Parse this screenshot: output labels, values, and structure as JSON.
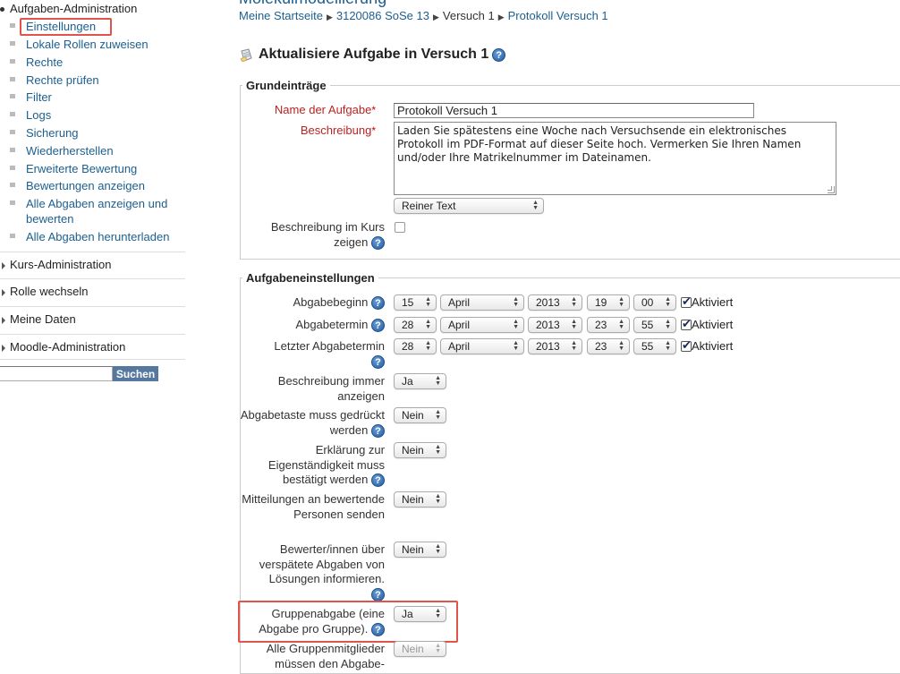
{
  "sidebar": {
    "section_title": "Aufgaben-Administration",
    "items": [
      {
        "label": "Einstellungen"
      },
      {
        "label": "Lokale Rollen zuweisen"
      },
      {
        "label": "Rechte"
      },
      {
        "label": "Rechte prüfen"
      },
      {
        "label": "Filter"
      },
      {
        "label": "Logs"
      },
      {
        "label": "Sicherung"
      },
      {
        "label": "Wiederherstellen"
      },
      {
        "label": "Erweiterte Bewertung"
      },
      {
        "label": "Bewertungen anzeigen"
      },
      {
        "label": "Alle Abgaben anzeigen und bewerten"
      },
      {
        "label": "Alle Abgaben herunterladen"
      }
    ],
    "blocks": [
      {
        "label": "Kurs-Administration"
      },
      {
        "label": "Rolle wechseln"
      },
      {
        "label": "Meine Daten"
      },
      {
        "label": "Moodle-Administration"
      }
    ],
    "search": {
      "value": "",
      "button_label": "Suchen"
    }
  },
  "header": {
    "course_title": "Molekülmodellierung",
    "breadcrumb": [
      "Meine Startseite",
      "3120086 SoSe 13",
      "Versuch 1",
      "Protokoll Versuch 1"
    ]
  },
  "page": {
    "heading": "Aktualisiere Aufgabe in Versuch 1",
    "help_symbol": "?"
  },
  "grundeintraege": {
    "legend": "Grundeinträge",
    "name_label": "Name der Aufgabe",
    "name_value": "Protokoll Versuch 1",
    "desc_label": "Beschreibung",
    "desc_value": "Laden Sie spätestens eine Woche nach Versuchsende ein elektronisches Protokoll im PDF-Format auf dieser Seite hoch. Vermerken Sie Ihren Namen und/oder Ihre Matrikelnummer im Dateinamen.",
    "format_value": "Reiner Text",
    "show_desc_label": "Beschreibung im Kurs zeigen",
    "show_desc_checked": false,
    "required_mark": "*"
  },
  "aufgabeneinstellungen": {
    "legend": "Aufgabeneinstellungen",
    "activated_label": "Aktiviert",
    "dates": [
      {
        "label": "Abgabebeginn",
        "day": "15",
        "month": "April",
        "year": "2013",
        "hour": "19",
        "minute": "00",
        "enabled": true
      },
      {
        "label": "Abgabetermin",
        "day": "28",
        "month": "April",
        "year": "2013",
        "hour": "23",
        "minute": "55",
        "enabled": true
      },
      {
        "label": "Letzter Abgabetermin",
        "day": "28",
        "month": "April",
        "year": "2013",
        "hour": "23",
        "minute": "55",
        "enabled": true
      }
    ],
    "options": [
      {
        "label": "Beschreibung immer anzeigen",
        "value": "Ja"
      },
      {
        "label": "Abgabetaste muss gedrückt werden",
        "value": "Nein"
      },
      {
        "label": "Erklärung zur Eigenständigkeit muss bestätigt werden",
        "value": "Nein"
      },
      {
        "label": "Mitteilungen an bewertende Personen senden",
        "value": "Nein"
      },
      {
        "label": "Bewerter/innen über verspätete Abgaben von Lösungen informieren.",
        "value": "Nein"
      },
      {
        "label": "Gruppenabgabe (eine Abgabe pro Gruppe).",
        "value": "Ja"
      },
      {
        "label": "Alle Gruppenmitglieder müssen den Abgabe-",
        "value": "Nein"
      }
    ]
  }
}
